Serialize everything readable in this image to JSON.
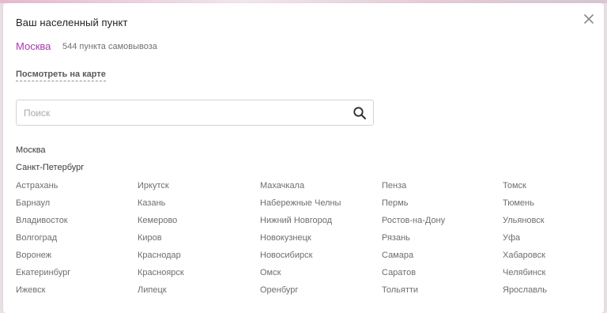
{
  "dialog": {
    "title": "Ваш населенный пункт",
    "current_city": "Москва",
    "pickup_points": "544 пункта самовывоза",
    "map_link": "Посмотреть на карте",
    "search_placeholder": "Поиск",
    "accent_color": "#a83aae"
  },
  "top_cities": [
    "Москва",
    "Санкт-Петербург"
  ],
  "city_columns": [
    [
      "Астрахань",
      "Барнаул",
      "Владивосток",
      "Волгоград",
      "Воронеж",
      "Екатеринбург",
      "Ижевск"
    ],
    [
      "Иркутск",
      "Казань",
      "Кемерово",
      "Киров",
      "Краснодар",
      "Красноярск",
      "Липецк"
    ],
    [
      "Махачкала",
      "Набережные Челны",
      "Нижний Новгород",
      "Новокузнецк",
      "Новосибирск",
      "Омск",
      "Оренбург"
    ],
    [
      "Пенза",
      "Пермь",
      "Ростов-на-Дону",
      "Рязань",
      "Самара",
      "Саратов",
      "Тольятти"
    ],
    [
      "Томск",
      "Тюмень",
      "Ульяновск",
      "Уфа",
      "Хабаровск",
      "Челябинск",
      "Ярославль"
    ]
  ]
}
